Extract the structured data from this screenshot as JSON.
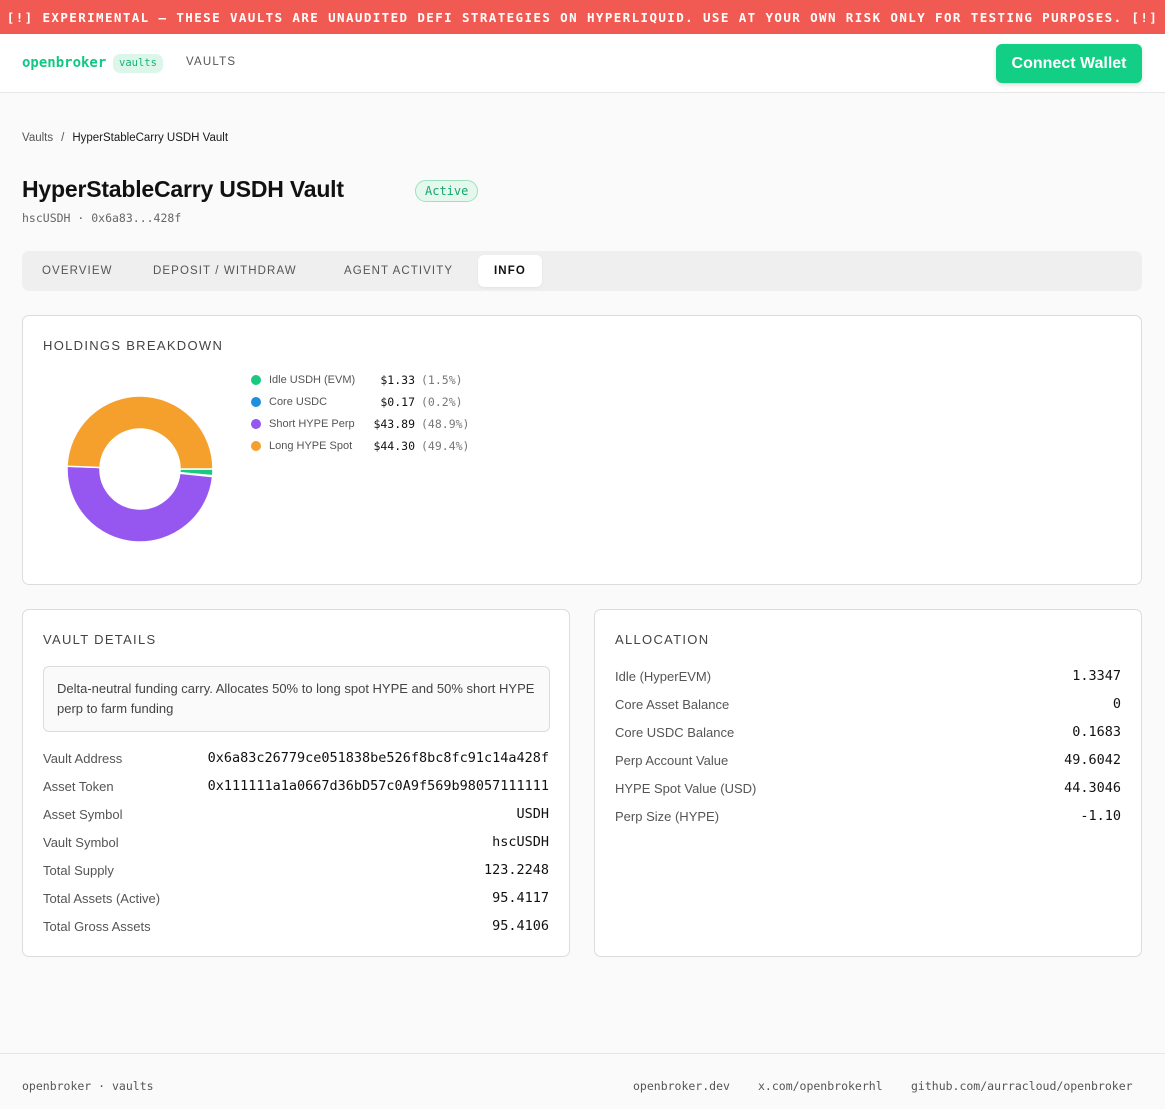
{
  "banner": {
    "text": "[!] EXPERIMENTAL — THESE VAULTS ARE UNAUDITED DEFI STRATEGIES ON HYPERLIQUID. USE AT YOUR OWN RISK ONLY FOR TESTING PURPOSES. [!]"
  },
  "nav": {
    "brand": "openbroker",
    "brand_pill": "vaults",
    "vaults_link": "VAULTS",
    "connect_wallet": "Connect Wallet"
  },
  "breadcrumb": {
    "root": "Vaults",
    "separator": "/",
    "current": "HyperStableCarry USDH Vault"
  },
  "vault": {
    "title": "HyperStableCarry USDH Vault",
    "status": "Active",
    "subtitle": "hscUSDH · 0x6a83...428f"
  },
  "tabs": [
    {
      "label": "OVERVIEW",
      "active": false
    },
    {
      "label": "DEPOSIT / WITHDRAW",
      "active": false
    },
    {
      "label": "AGENT ACTIVITY",
      "active": false
    },
    {
      "label": "INFO",
      "active": true
    }
  ],
  "holdings": {
    "title": "HOLDINGS BREAKDOWN",
    "items": [
      {
        "label": "Idle USDH (EVM)",
        "value": "$1.33",
        "pct": "(1.5%)",
        "color": "#19c97f"
      },
      {
        "label": "Core USDC",
        "value": "$0.17",
        "pct": "(0.2%)",
        "color": "#1e8fe0"
      },
      {
        "label": "Short HYPE Perp",
        "value": "$43.89",
        "pct": "(48.9%)",
        "color": "#9656f0"
      },
      {
        "label": "Long HYPE Spot",
        "value": "$44.30",
        "pct": "(49.4%)",
        "color": "#f5a02c"
      }
    ]
  },
  "vault_details": {
    "title": "VAULT DETAILS",
    "description": "Delta-neutral funding carry. Allocates 50% to long spot HYPE and 50% short HYPE perp to farm funding",
    "rows": [
      {
        "label": "Vault Address",
        "value": "0x6a83c26779ce051838be526f8bc8fc91c14a428f"
      },
      {
        "label": "Asset Token",
        "value": "0x111111a1a0667d36bD57c0A9f569b98057111111"
      },
      {
        "label": "Asset Symbol",
        "value": "USDH"
      },
      {
        "label": "Vault Symbol",
        "value": "hscUSDH"
      },
      {
        "label": "Total Supply",
        "value": "123.2248"
      },
      {
        "label": "Total Assets (Active)",
        "value": "95.4117"
      },
      {
        "label": "Total Gross Assets",
        "value": "95.4106"
      }
    ]
  },
  "allocation": {
    "title": "ALLOCATION",
    "rows": [
      {
        "label": "Idle (HyperEVM)",
        "value": "1.3347"
      },
      {
        "label": "Core Asset Balance",
        "value": "0"
      },
      {
        "label": "Core USDC Balance",
        "value": "0.1683"
      },
      {
        "label": "Perp Account Value",
        "value": "49.6042"
      },
      {
        "label": "HYPE Spot Value (USD)",
        "value": "44.3046"
      },
      {
        "label": "Perp Size (HYPE)",
        "value": "-1.10"
      }
    ]
  },
  "footer": {
    "left": "openbroker · vaults",
    "links": [
      "openbroker.dev",
      "x.com/openbrokerhl",
      "github.com/aurracloud/openbroker"
    ]
  },
  "chart_data": {
    "type": "pie",
    "categories": [
      "Idle USDH (EVM)",
      "Core USDC",
      "Short HYPE Perp",
      "Long HYPE Spot"
    ],
    "values": [
      1.33,
      0.17,
      43.89,
      44.3
    ],
    "colors": [
      "#19c97f",
      "#1e8fe0",
      "#9656f0",
      "#f5a02c"
    ],
    "title": "HOLDINGS BREAKDOWN"
  }
}
